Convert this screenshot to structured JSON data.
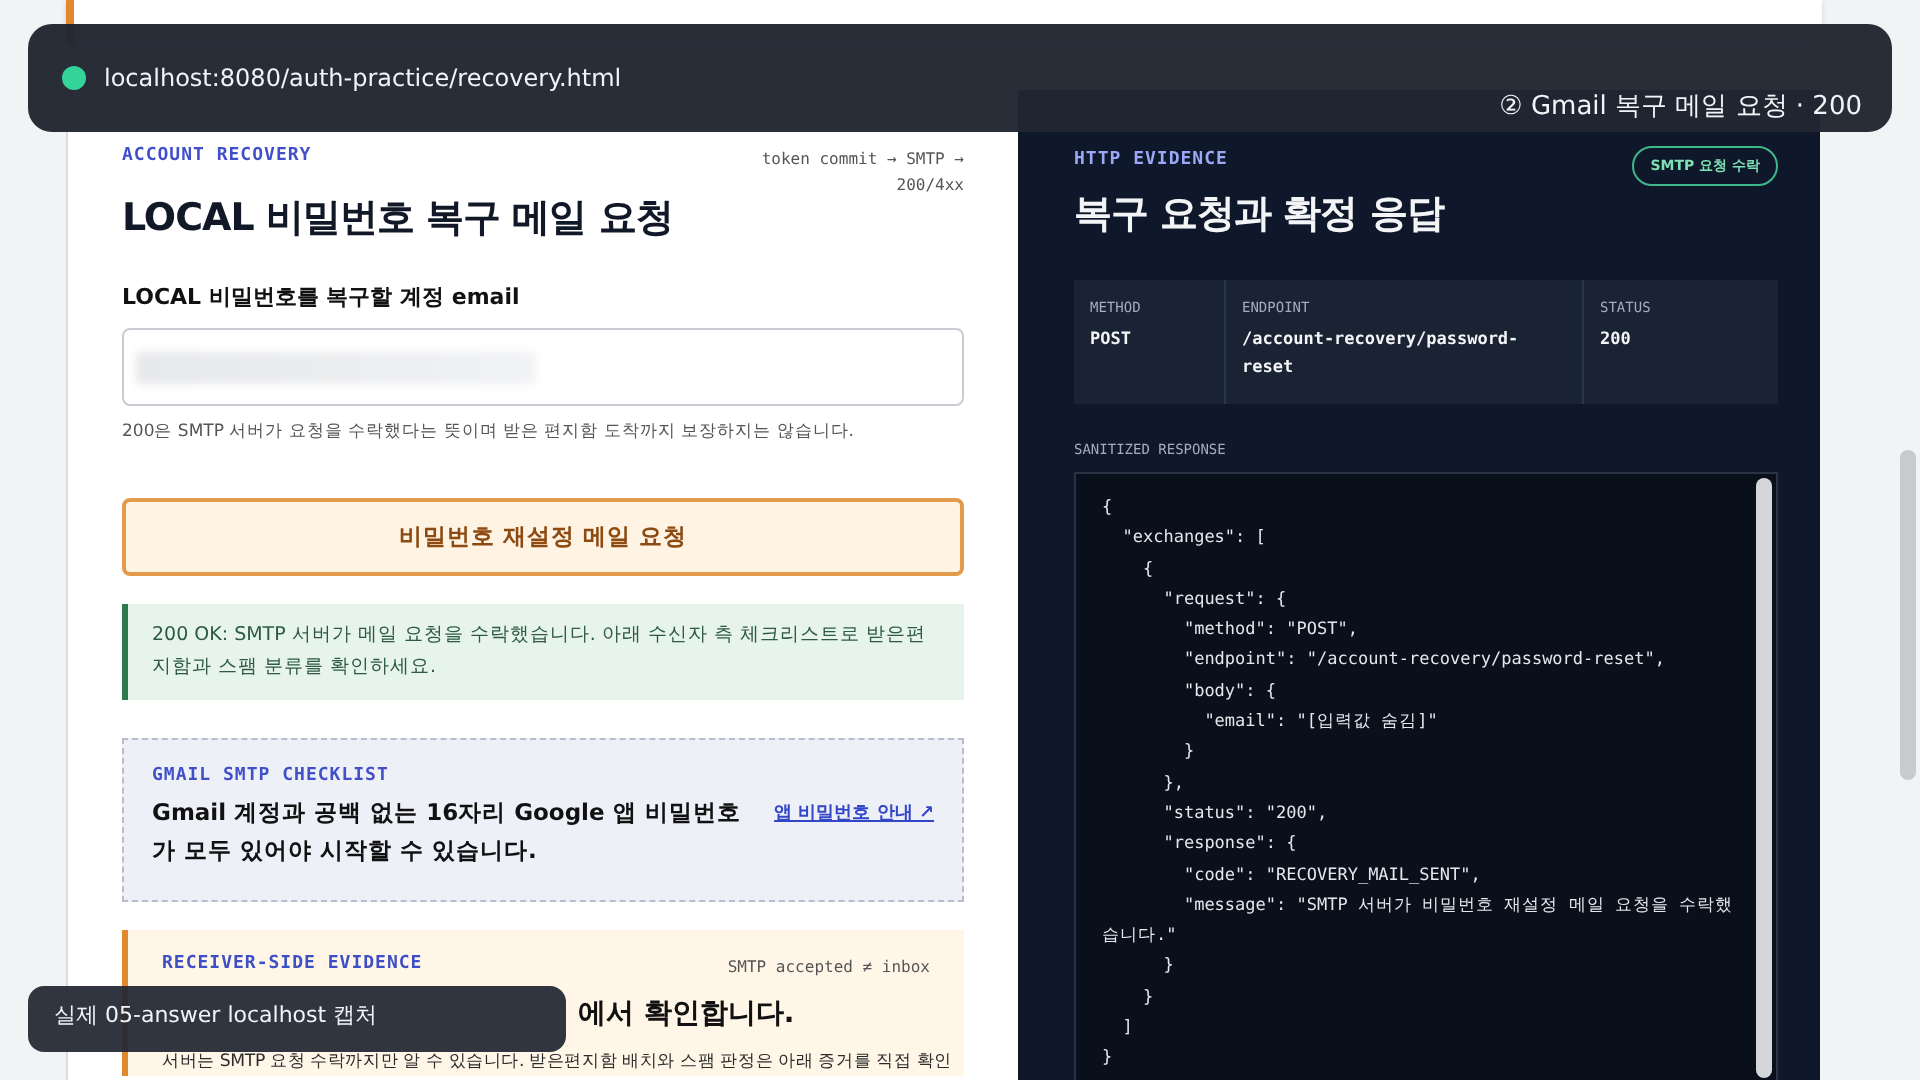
{
  "capture_bar": {
    "url": "localhost:8080/auth-practice/recovery.html",
    "step": "② Gmail 복구 메일 요청 · 200"
  },
  "request_panel": {
    "eyebrow": "ACCOUNT RECOVERY",
    "flow": "token commit → SMTP → 200/4xx",
    "title": "LOCAL 비밀번호 복구 메일 요청",
    "email_label": "LOCAL 비밀번호를 복구할 계정 email",
    "email_value_redacted": true,
    "help": "200은 SMTP 서버가 요청을 수락했다는 뜻이며 받은 편지함 도착까지 보장하지는 않습니다.",
    "submit_button": "비밀번호 재설정 메일 요청",
    "alert": {
      "kind": "success",
      "text": "200 OK: SMTP 서버가 메일 요청을 수락했습니다. 아래 수신자 측 체크리스트로 받은편지함과 스팸 분류를 확인하세요."
    },
    "checklist": {
      "eyebrow": "GMAIL SMTP CHECKLIST",
      "text": "Gmail 계정과 공백 없는 16자리 Google 앱 비밀번호가 모두 있어야 시작할 수 있습니다.",
      "link": "앱 비밀번호 안내 ↗"
    },
    "receiver": {
      "eyebrow": "RECEIVER-SIDE EVIDENCE",
      "note": "SMTP accepted ≠ inbox",
      "title": "에서 확인합니다.",
      "text": "서버는 SMTP 요청 수락까지만 알 수 있습니다. 받은편지함 배치와 스팸 판정은 아래 증거를 직접 확인"
    }
  },
  "evidence_panel": {
    "eyebrow": "HTTP EVIDENCE",
    "badge": "SMTP 요청 수락",
    "title": "복구 요청과 확정 응답",
    "metrics": [
      {
        "label": "METHOD",
        "value": "POST"
      },
      {
        "label": "ENDPOINT",
        "value": "/account-recovery/password-reset"
      },
      {
        "label": "STATUS",
        "value": "200"
      }
    ],
    "response_label": "SANITIZED RESPONSE",
    "response_lines": [
      "{",
      "  \"exchanges\": [",
      "    {",
      "      \"request\": {",
      "        \"method\": \"POST\",",
      "        \"endpoint\": \"/account-recovery/password-reset\",",
      "        \"body\": {",
      "          \"email\": \"[입력값 숨김]\"",
      "        }",
      "      },",
      "      \"status\": \"200\",",
      "      \"response\": {",
      "        \"code\": \"RECOVERY_MAIL_SENT\",",
      "        \"message\": \"SMTP 서버가 비밀번호 재설정 메일 요청을 수락했습니다.\"",
      "      }",
      "    }",
      "  ]",
      "}"
    ]
  },
  "caption": "실제 05-answer localhost 캡처"
}
